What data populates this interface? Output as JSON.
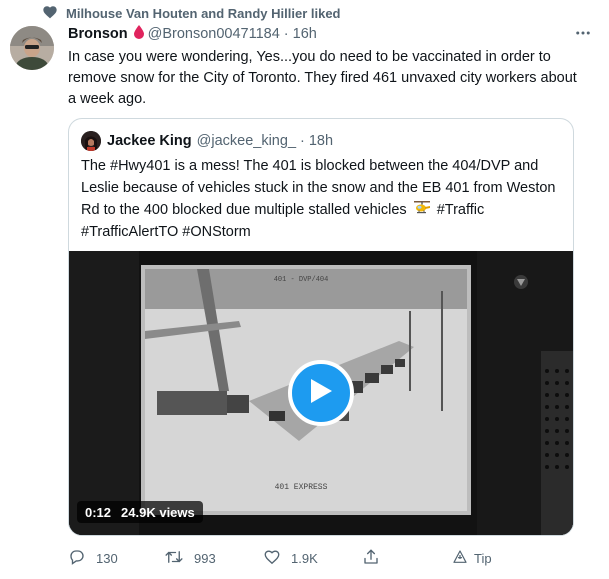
{
  "social_context": {
    "text": "Milhouse Van Houten and Randy Hillier liked"
  },
  "tweet": {
    "author_name": "Bronson",
    "handle": "@Bronson00471184",
    "separator": "·",
    "time": "16h",
    "text": "In case you were wondering, Yes...you do need to be vaccinated in order to remove snow for the City of Toronto.  They fired 461 unvaxed city workers about a week ago."
  },
  "quote": {
    "author_name": "Jackee King",
    "handle": "@jackee_king_",
    "separator": "·",
    "time": "18h",
    "text_before": "The #Hwy401 is a mess! The 401 is blocked between the 404/DVP and Leslie because of vehicles stuck in the snow and the EB 401 from Weston Rd to the 400 blocked due multiple stalled vehicles",
    "text_after": "#Traffic #TrafficAlertTO #ONStorm",
    "media": {
      "duration": "0:12",
      "views": "24.9K views",
      "camera_label_top": "401 - DVP/404",
      "camera_label_bottom": "401 EXPRESS"
    }
  },
  "actions": {
    "reply_count": "130",
    "retweet_count": "993",
    "like_count": "1.9K",
    "tip_label": "Tip"
  },
  "colors": {
    "accent": "#1d9bf0",
    "secondary_text": "#536471",
    "border": "#cfd9de",
    "drop": "#e0245e"
  }
}
